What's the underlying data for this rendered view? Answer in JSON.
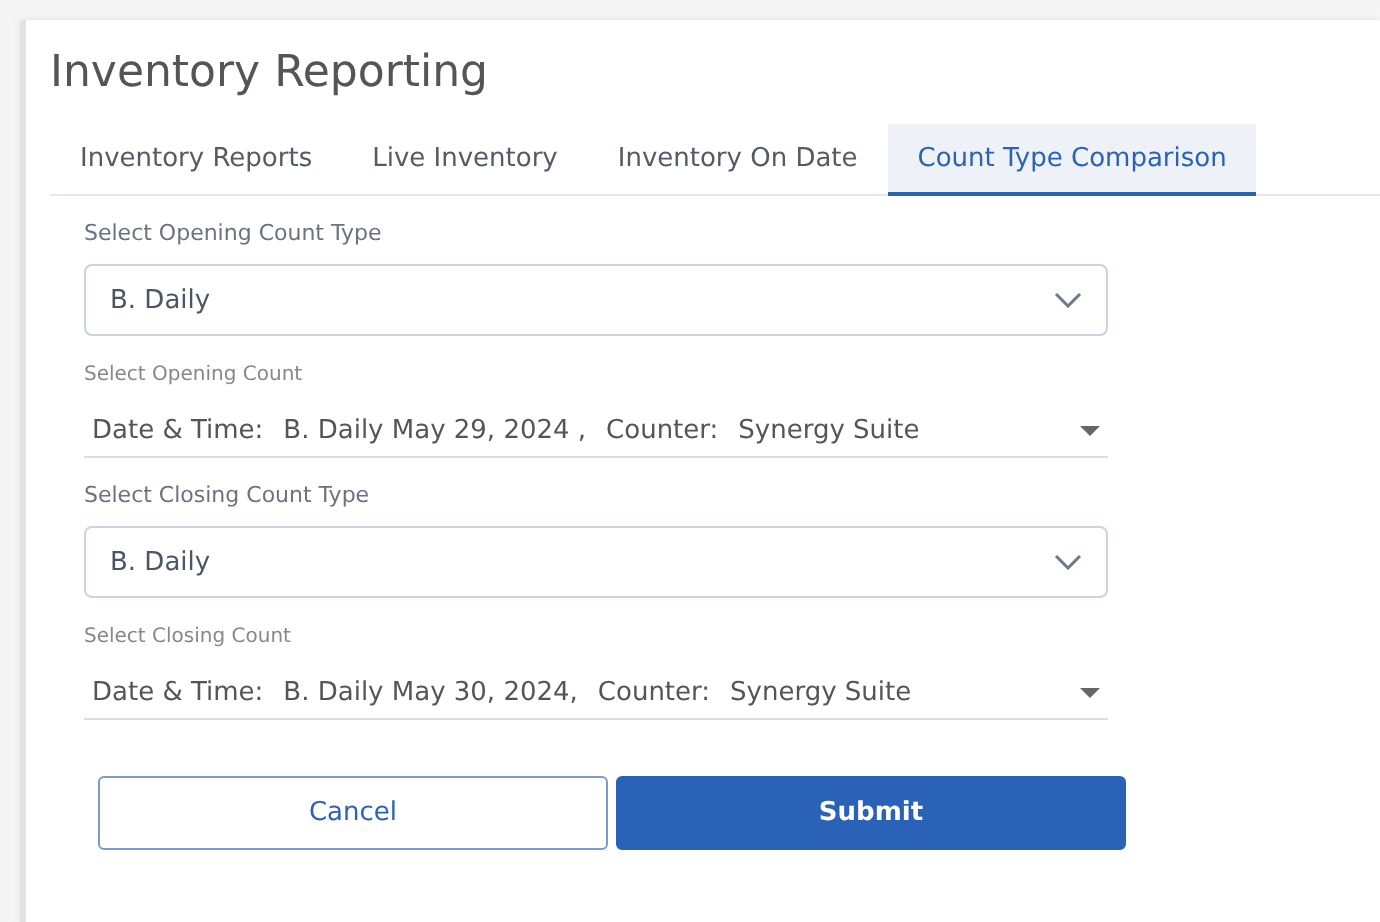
{
  "title": "Inventory Reporting",
  "tabs": [
    {
      "label": "Inventory Reports",
      "selected": false
    },
    {
      "label": "Live Inventory",
      "selected": false
    },
    {
      "label": "Inventory On Date",
      "selected": false
    },
    {
      "label": "Count Type Comparison",
      "selected": true
    }
  ],
  "fields": [
    {
      "kind": "select",
      "label": "Select Opening Count Type",
      "value": "B. Daily"
    },
    {
      "kind": "count",
      "label": "Select Opening Count",
      "date_label": "Date & Time:",
      "date_value": "B. Daily May 29, 2024 ,",
      "counter_label": "Counter:",
      "counter_value": "Synergy Suite"
    },
    {
      "kind": "select",
      "label": "Select Closing Count Type",
      "value": "B. Daily"
    },
    {
      "kind": "count",
      "label": "Select Closing Count",
      "date_label": "Date & Time:",
      "date_value": "B. Daily May 30, 2024,",
      "counter_label": "Counter:",
      "counter_value": "Synergy Suite"
    }
  ],
  "buttons": [
    {
      "kind": "secondary",
      "label": "Cancel"
    },
    {
      "kind": "primary",
      "label": "Submit"
    }
  ]
}
